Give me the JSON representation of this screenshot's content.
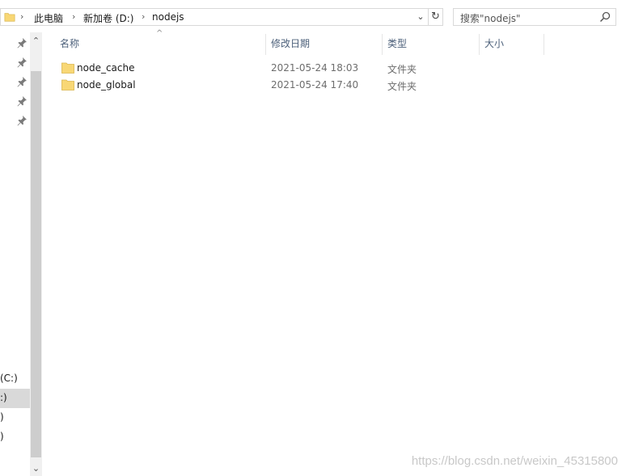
{
  "address_bar": {
    "breadcrumbs": [
      "此电脑",
      "新加卷 (D:)",
      "nodejs"
    ],
    "separator": "›"
  },
  "search": {
    "placeholder": "搜索\"nodejs\""
  },
  "columns": {
    "name": "名称",
    "date": "修改日期",
    "type": "类型",
    "size": "大小"
  },
  "files": [
    {
      "name": "node_cache",
      "modified": "2021-05-24 18:03",
      "type": "文件夹",
      "icon": "folder-icon"
    },
    {
      "name": "node_global",
      "modified": "2021-05-24 17:40",
      "type": "文件夹",
      "icon": "folder-icon"
    }
  ],
  "nav": {
    "drives": [
      "(C:)",
      ":)",
      ")",
      ")"
    ],
    "selected_index": 1
  },
  "watermark": "https://blog.csdn.net/weixin_45315800",
  "colors": {
    "header_text": "#4c607a",
    "folder": "#f8d775",
    "selected": "#d9d9d9"
  }
}
